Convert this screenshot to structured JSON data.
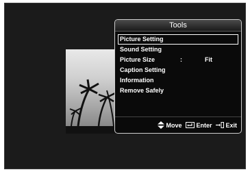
{
  "tools": {
    "title": "Tools",
    "items": [
      {
        "label": "Picture Setting",
        "separator": "",
        "value": ""
      },
      {
        "label": "Sound Setting",
        "separator": "",
        "value": ""
      },
      {
        "label": "Picture Size",
        "separator": ":",
        "value": "Fit"
      },
      {
        "label": "Caption Setting",
        "separator": "",
        "value": ""
      },
      {
        "label": "Information",
        "separator": "",
        "value": ""
      },
      {
        "label": "Remove Safely",
        "separator": "",
        "value": ""
      }
    ],
    "selected_index": 0
  },
  "footer": {
    "move_label": "Move",
    "enter_label": "Enter",
    "exit_label": "Exit"
  },
  "colors": {
    "panel_bg": "#0a0a0a",
    "panel_border": "#cfcfcf",
    "text": "#ffffff",
    "screen_bg": "#1b1b1b"
  },
  "icons": {
    "move": "up-down-arrows-icon",
    "enter": "enter-icon",
    "exit": "exit-icon"
  }
}
